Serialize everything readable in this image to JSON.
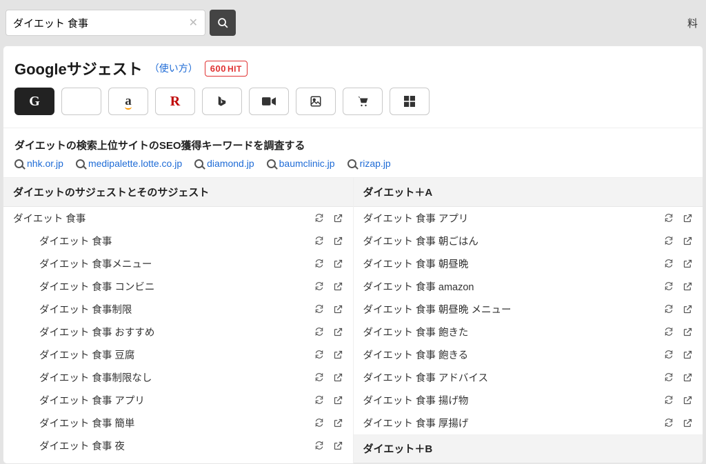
{
  "search": {
    "value": "ダイエット 食事"
  },
  "top_right": "料",
  "header": {
    "title": "Googleサジェスト",
    "usage_label": "（使い方）",
    "hit_count": "600",
    "hit_suffix": "HIT"
  },
  "providers": [
    {
      "key": "google",
      "name": "google-icon",
      "active": true
    },
    {
      "key": "youtube",
      "name": "youtube-icon",
      "active": false
    },
    {
      "key": "amazon",
      "name": "amazon-icon",
      "active": false
    },
    {
      "key": "rakuten",
      "name": "rakuten-icon",
      "active": false
    },
    {
      "key": "bing",
      "name": "bing-icon",
      "active": false
    },
    {
      "key": "video",
      "name": "video-icon",
      "active": false
    },
    {
      "key": "image",
      "name": "image-icon",
      "active": false
    },
    {
      "key": "shopping",
      "name": "shopping-icon",
      "active": false
    },
    {
      "key": "windows",
      "name": "windows-icon",
      "active": false
    }
  ],
  "seo": {
    "title": "ダイエットの検索上位サイトのSEO獲得キーワードを調査する",
    "sites": [
      "nhk.or.jp",
      "medipalette.lotte.co.jp",
      "diamond.jp",
      "baumclinic.jp",
      "rizap.jp"
    ]
  },
  "columns": {
    "left": {
      "header": "ダイエットのサジェストとそのサジェスト",
      "rows": [
        {
          "text": "ダイエット 食事",
          "indent": false
        },
        {
          "text": "ダイエット 食事",
          "indent": true
        },
        {
          "text": "ダイエット 食事メニュー",
          "indent": true
        },
        {
          "text": "ダイエット 食事 コンビニ",
          "indent": true
        },
        {
          "text": "ダイエット 食事制限",
          "indent": true
        },
        {
          "text": "ダイエット 食事 おすすめ",
          "indent": true
        },
        {
          "text": "ダイエット 食事 豆腐",
          "indent": true
        },
        {
          "text": "ダイエット 食事制限なし",
          "indent": true
        },
        {
          "text": "ダイエット 食事 アプリ",
          "indent": true
        },
        {
          "text": "ダイエット 食事 簡単",
          "indent": true
        },
        {
          "text": "ダイエット 食事 夜",
          "indent": true
        }
      ]
    },
    "right": {
      "header": "ダイエット＋A",
      "rows": [
        {
          "text": "ダイエット 食事 アプリ",
          "indent": false
        },
        {
          "text": "ダイエット 食事 朝ごはん",
          "indent": false
        },
        {
          "text": "ダイエット 食事 朝昼晩",
          "indent": false
        },
        {
          "text": "ダイエット 食事 amazon",
          "indent": false
        },
        {
          "text": "ダイエット 食事 朝昼晩 メニュー",
          "indent": false
        },
        {
          "text": "ダイエット 食事 飽きた",
          "indent": false
        },
        {
          "text": "ダイエット 食事 飽きる",
          "indent": false
        },
        {
          "text": "ダイエット 食事 アドバイス",
          "indent": false
        },
        {
          "text": "ダイエット 食事 揚げ物",
          "indent": false
        },
        {
          "text": "ダイエット 食事 厚揚げ",
          "indent": false
        }
      ],
      "footer": "ダイエット＋B"
    }
  }
}
